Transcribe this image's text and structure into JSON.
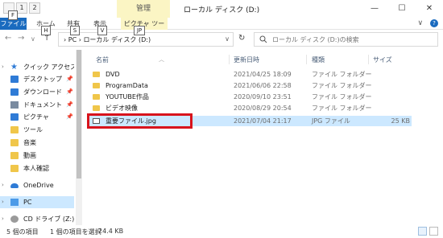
{
  "quick_access_toolbar": [
    "1",
    "2"
  ],
  "ribbon": {
    "manage_label": "管理",
    "tabs": {
      "file": "ファイル",
      "home": "ホーム",
      "share": "共有",
      "view": "表示",
      "picture_tools": "ピクチャ ツール"
    },
    "keytips": {
      "f": "F",
      "h": "H",
      "s": "S",
      "v": "V",
      "jp": "JP"
    }
  },
  "window": {
    "title": "ローカル ディスク (D:)",
    "controls": [
      "—",
      "☐",
      "✕"
    ]
  },
  "navigation": {
    "back": "←",
    "forward": "→",
    "recent": "∨",
    "up": "↑"
  },
  "address_bar": {
    "path": "›  PC  ›  ローカル ディスク (D:)",
    "dropdown": "∨",
    "refresh": "↻"
  },
  "search": {
    "placeholder": "ローカル ディスク (D:)の検索"
  },
  "sidebar": {
    "items": [
      {
        "label": "クイック アクセス",
        "icon": "star-icon",
        "pinned": false
      },
      {
        "label": "デスクトップ",
        "icon": "desktop-icon",
        "pinned": true
      },
      {
        "label": "ダウンロード",
        "icon": "download-icon",
        "pinned": true
      },
      {
        "label": "ドキュメント",
        "icon": "document-icon",
        "pinned": true
      },
      {
        "label": "ピクチャ",
        "icon": "pictures-icon",
        "pinned": true
      },
      {
        "label": "ツール",
        "icon": "folder-icon",
        "pinned": false
      },
      {
        "label": "音楽",
        "icon": "folder-icon",
        "pinned": false
      },
      {
        "label": "動画",
        "icon": "folder-icon",
        "pinned": false
      },
      {
        "label": "本人確認",
        "icon": "folder-icon",
        "pinned": false
      },
      {
        "label": "OneDrive",
        "icon": "cloud-icon",
        "pinned": false
      },
      {
        "label": "PC",
        "icon": "pc-icon",
        "pinned": false,
        "selected": true
      },
      {
        "label": "CD ドライブ (Z:) DV",
        "icon": "cd-drive-icon",
        "pinned": false
      }
    ],
    "pin_glyph": "📌"
  },
  "columns": {
    "name": "名前",
    "date": "更新日時",
    "type": "種類",
    "size": "サイズ"
  },
  "files": [
    {
      "name": "DVD",
      "date": "2021/04/25 18:09",
      "type": "ファイル フォルダー",
      "size": "",
      "kind": "folder"
    },
    {
      "name": "ProgramData",
      "date": "2021/06/06 22:58",
      "type": "ファイル フォルダー",
      "size": "",
      "kind": "folder"
    },
    {
      "name": "YOUTUBE作品",
      "date": "2020/09/10 23:51",
      "type": "ファイル フォルダー",
      "size": "",
      "kind": "folder"
    },
    {
      "name": "ビデオ映像",
      "date": "2020/08/29 20:54",
      "type": "ファイル フォルダー",
      "size": "",
      "kind": "folder"
    },
    {
      "name": "重要ファイル.jpg",
      "date": "2021/07/04 21:17",
      "type": "JPG ファイル",
      "size": "25 KB",
      "kind": "image",
      "selected": true
    }
  ],
  "status": {
    "count": "5 個の項目",
    "selection": "1 個の項目を選択",
    "size": "24.4 KB"
  },
  "colors": {
    "accent": "#1a6bbf",
    "selection": "#cce8ff",
    "highlight_box": "#d8131c",
    "manage_tab": "#fbf5c4"
  }
}
